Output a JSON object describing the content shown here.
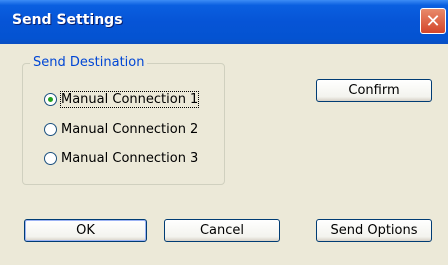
{
  "window": {
    "title": "Send Settings",
    "close_symbol": "✕"
  },
  "group": {
    "label": "Send Destination",
    "options": [
      {
        "label": "Manual Connection 1",
        "selected": true
      },
      {
        "label": "Manual Connection 2",
        "selected": false
      },
      {
        "label": "Manual Connection 3",
        "selected": false
      }
    ]
  },
  "buttons": {
    "confirm": "Confirm",
    "ok": "OK",
    "cancel": "Cancel",
    "send_options": "Send Options"
  }
}
